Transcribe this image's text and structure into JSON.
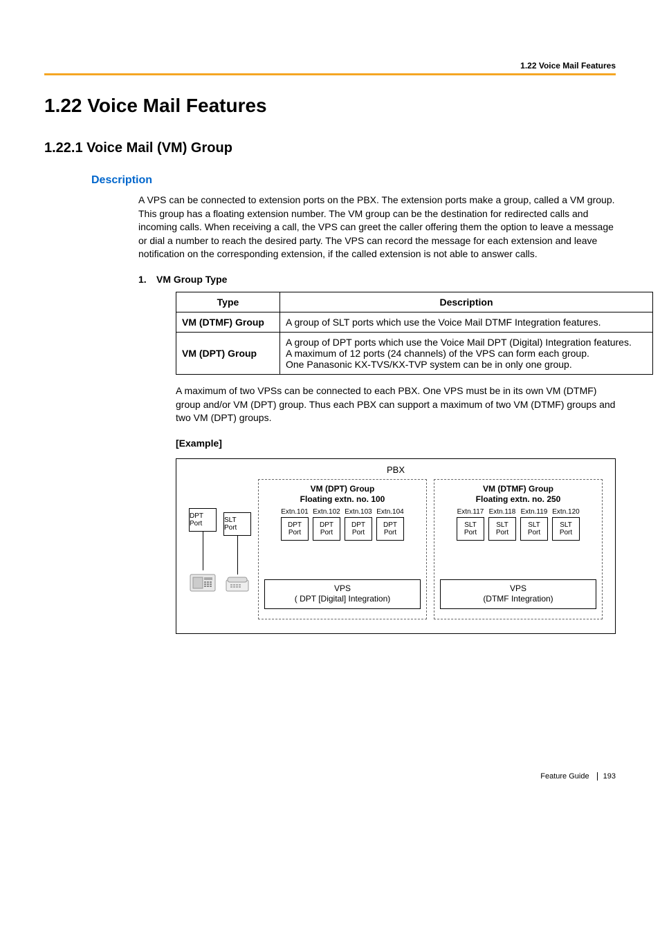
{
  "header": {
    "breadcrumb": "1.22 Voice Mail Features"
  },
  "h1": "1.22   Voice Mail Features",
  "h2": "1.22.1  Voice Mail (VM) Group",
  "description_heading": "Description",
  "intro": "A VPS can be connected to extension ports on the PBX. The extension ports make a group, called a VM group. This group has a floating extension number. The VM group can be the destination for redirected calls and incoming calls. When receiving a call, the VPS can greet the caller offering them the option to leave a message or dial a number to reach the desired party. The VPS can record the message for each extension and leave notification on the corresponding extension, if the called extension is not able to answer calls.",
  "list_item_1_num": "1.",
  "list_item_1_label": "VM Group Type",
  "table": {
    "headers": {
      "c1": "Type",
      "c2": "Description"
    },
    "rows": [
      {
        "type": "VM (DTMF) Group",
        "desc": "A group of SLT ports which use the Voice Mail DTMF Integration features."
      },
      {
        "type": "VM (DPT) Group",
        "desc": "A group of DPT ports which use the Voice Mail DPT (Digital) Integration features.\nA maximum of 12 ports (24 channels) of the VPS can form each group.\nOne Panasonic KX-TVS/KX-TVP system can be in only one group."
      }
    ]
  },
  "after_table": "A maximum of two VPSs can be connected to each PBX. One VPS must be in its own VM (DTMF) group and/or VM (DPT) group. Thus each PBX can support a maximum of two VM (DTMF) groups and two VM (DPT) groups.",
  "example_label": "[Example]",
  "diagram": {
    "pbx": "PBX",
    "left_ports": [
      {
        "type": "DPT",
        "port": "Port"
      },
      {
        "type": "SLT",
        "port": "Port"
      }
    ],
    "dpt_group": {
      "title_l1": "VM (DPT) Group",
      "title_l2": "Floating extn. no. 100",
      "extns": [
        "Extn.101",
        "Extn.102",
        "Extn.103",
        "Extn.104"
      ],
      "port_type": "DPT",
      "port_label": "Port",
      "vps_l1": "VPS",
      "vps_l2": "( DPT [Digital] Integration)"
    },
    "dtmf_group": {
      "title_l1": "VM (DTMF) Group",
      "title_l2": "Floating extn. no. 250",
      "extns": [
        "Extn.117",
        "Extn.118",
        "Extn.119",
        "Extn.120"
      ],
      "port_type": "SLT",
      "port_label": "Port",
      "vps_l1": "VPS",
      "vps_l2": "(DTMF Integration)"
    }
  },
  "footer": {
    "guide": "Feature Guide",
    "page": "193"
  }
}
